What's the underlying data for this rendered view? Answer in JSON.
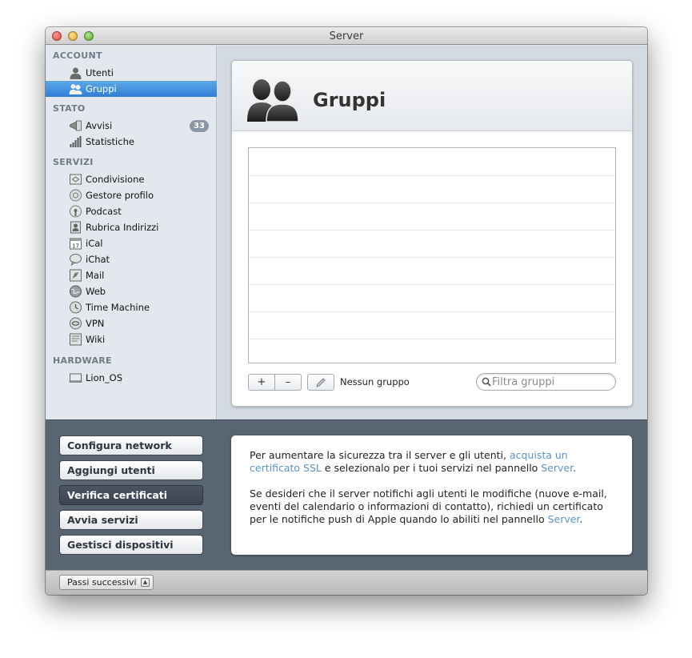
{
  "window": {
    "title": "Server"
  },
  "sidebar": {
    "sections": [
      {
        "header": "ACCOUNT",
        "items": [
          {
            "label": "Utenti",
            "icon": "user-icon"
          },
          {
            "label": "Gruppi",
            "icon": "group-icon",
            "selected": true
          }
        ]
      },
      {
        "header": "STATO",
        "items": [
          {
            "label": "Avvisi",
            "icon": "megaphone-icon",
            "badge": "33"
          },
          {
            "label": "Statistiche",
            "icon": "bar-chart-icon"
          }
        ]
      },
      {
        "header": "SERVIZI",
        "items": [
          {
            "label": "Condivisione",
            "icon": "file-sharing-icon"
          },
          {
            "label": "Gestore profilo",
            "icon": "profile-manager-icon"
          },
          {
            "label": "Podcast",
            "icon": "podcast-icon"
          },
          {
            "label": "Rubrica Indirizzi",
            "icon": "address-book-icon"
          },
          {
            "label": "iCal",
            "icon": "calendar-icon"
          },
          {
            "label": "iChat",
            "icon": "chat-bubble-icon"
          },
          {
            "label": "Mail",
            "icon": "mail-icon"
          },
          {
            "label": "Web",
            "icon": "globe-icon"
          },
          {
            "label": "Time Machine",
            "icon": "time-machine-icon"
          },
          {
            "label": "VPN",
            "icon": "vpn-icon"
          },
          {
            "label": "Wiki",
            "icon": "wiki-icon"
          }
        ]
      },
      {
        "header": "HARDWARE",
        "items": [
          {
            "label": "Lion_OS",
            "icon": "server-computer-icon"
          }
        ]
      }
    ]
  },
  "main": {
    "title": "Gruppi",
    "toolbar": {
      "add_label": "+",
      "remove_label": "–",
      "status": "Nessun gruppo"
    },
    "filter": {
      "placeholder": "Filtra gruppi",
      "value": ""
    }
  },
  "bottom": {
    "actions": [
      {
        "label": "Configura network"
      },
      {
        "label": "Aggiungi utenti"
      },
      {
        "label": "Verifica certificati",
        "active": true
      },
      {
        "label": "Avvia servizi"
      },
      {
        "label": "Gestisci dispositivi"
      }
    ],
    "info": {
      "p1_a": "Per aumentare la sicurezza tra il server e gli utenti, ",
      "p1_link1": "acquista un certificato SSL",
      "p1_b": " e selezionalo per i tuoi servizi nel pannello ",
      "p1_link2": "Server",
      "p1_c": ".",
      "p2_a": "Se desideri che il server notifichi agli utenti le modifiche (nuove e-mail, eventi del calendario o informazioni di contatto), richiedi un certificato per le notifiche push di Apple quando lo abiliti nel pannello ",
      "p2_link": "Server",
      "p2_b": "."
    }
  },
  "bottombar": {
    "next_label": "Passi successivi",
    "caret": "▲"
  }
}
